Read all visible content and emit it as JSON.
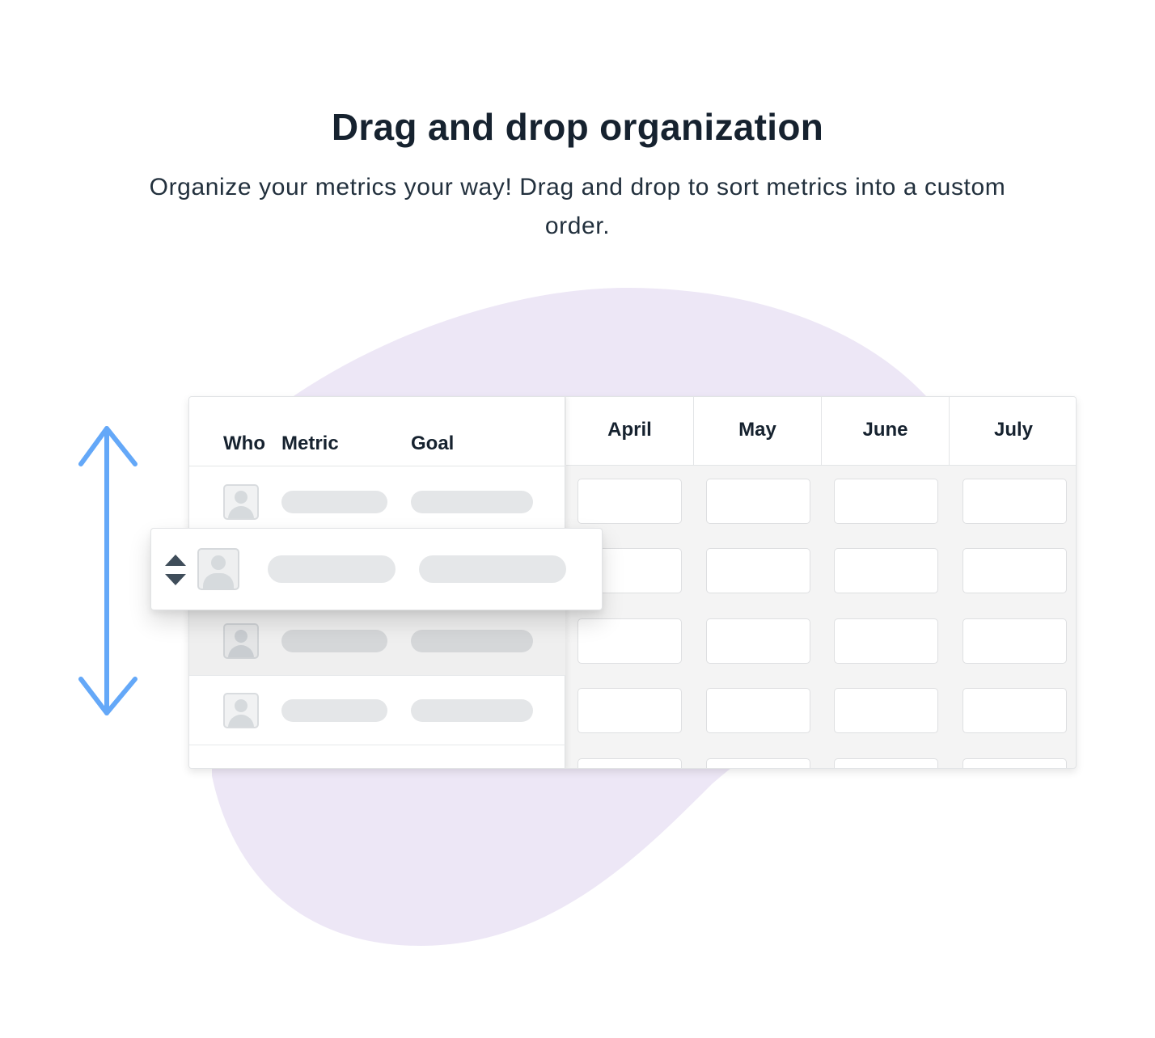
{
  "header": {
    "title": "Drag and drop organization",
    "subtitle": "Organize your metrics your way! Drag and drop to sort metrics into a custom order."
  },
  "table": {
    "columns": {
      "who": "Who",
      "metric": "Metric",
      "goal": "Goal"
    },
    "months": [
      "April",
      "May",
      "June",
      "July"
    ]
  },
  "colors": {
    "blob": "#ede7f6",
    "arrow": "#64a8f8",
    "sort_icon": "#3f4d5a"
  },
  "icons": {
    "vertical_arrow": "double-headed-vertical-arrow",
    "sort": "sort-up-down-icon",
    "avatar": "user-avatar-icon"
  }
}
